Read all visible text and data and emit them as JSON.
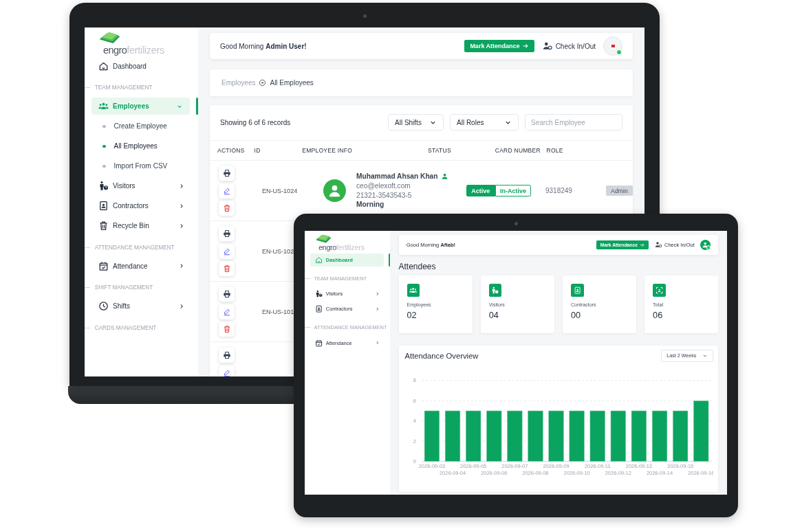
{
  "laptop": {
    "sidebar": {
      "logo": {
        "brand": "engro",
        "suffix": "fertilizers"
      },
      "items": [
        {
          "kind": "dashboard",
          "label": "Dashboard",
          "selected": false
        },
        {
          "kind": "section",
          "label": "TEAM MANAGEMENT"
        },
        {
          "kind": "employees",
          "label": "Employees",
          "selected": true,
          "expanded": true,
          "children": [
            {
              "label": "Create Employee",
              "selected": false
            },
            {
              "label": "All Employees",
              "selected": true
            },
            {
              "label": "Import From CSV",
              "selected": false
            }
          ]
        },
        {
          "kind": "visitors",
          "label": "Visitors",
          "selected": false,
          "expanded": false
        },
        {
          "kind": "contractors",
          "label": "Contractors",
          "selected": false,
          "expanded": false
        },
        {
          "kind": "recycle",
          "label": "Recycle Bin",
          "selected": false,
          "expanded": false
        },
        {
          "kind": "section",
          "label": "ATTENDANCE MANAGEMENT"
        },
        {
          "kind": "attendance",
          "label": "Attendance",
          "selected": false,
          "expanded": false
        },
        {
          "kind": "section",
          "label": "SHIFT MANAGEMENT"
        },
        {
          "kind": "shifts",
          "label": "Shifts",
          "selected": false,
          "expanded": false
        },
        {
          "kind": "section",
          "label": "CARDS MANAGEMENT"
        }
      ]
    },
    "header": {
      "greeting": "Good Morning **Admin User!**",
      "action": "Mark Attendance",
      "check": "Check In/Out",
      "avatar": {
        "kind": "logo",
        "online": true
      }
    },
    "breadcrumb": [
      {
        "label": "Employees",
        "selected": false
      },
      {
        "label": "All Employees",
        "selected": true
      }
    ],
    "toolbar": {
      "summary": "Showing 6 of 6 records",
      "filters": [
        "All Shifts",
        "All Roles"
      ],
      "search": {
        "placeholder": "Search Employee"
      }
    },
    "table": {
      "columns": [
        "ACTIONS",
        "ID",
        "EMPLOYEE INFO",
        "STATUS",
        "CARD NUMBER",
        "ROLE"
      ],
      "rows": [
        {
          "kind": "full",
          "id": "EN-US-1024",
          "name": "Muhammad Ahsan Khan",
          "email": "ceo@elexoft.com",
          "cnic": "21321-3543543-5",
          "shift": "Morning",
          "status": [
            {
              "label": "Active",
              "selected": true
            },
            {
              "label": "In-Active",
              "selected": false
            }
          ],
          "card": "9318249",
          "role": "Admin"
        },
        {
          "kind": "partial",
          "id": "EN-US-102"
        },
        {
          "kind": "partial",
          "id": "EN-US-101"
        },
        {
          "kind": "cut"
        }
      ]
    }
  },
  "tablet": {
    "sidebar": {
      "logo": {
        "brand": "engro",
        "suffix": "fertilizers"
      },
      "items": [
        {
          "kind": "dashboard",
          "label": "Dashboard",
          "selected": true
        },
        {
          "kind": "section",
          "label": "TEAM MANAGEMENT"
        },
        {
          "kind": "visitors",
          "label": "Visitors",
          "selected": false,
          "expanded": false
        },
        {
          "kind": "contractors",
          "label": "Contractors",
          "selected": false,
          "expanded": false
        },
        {
          "kind": "section",
          "label": "ATTENDANCE MANAGEMENT"
        },
        {
          "kind": "attendance",
          "label": "Attendance",
          "selected": false,
          "expanded": false
        }
      ]
    },
    "header": {
      "greeting": "Good Morning **Aftab!**",
      "action": "Mark Attendance",
      "check": "Check In/Out",
      "avatar": {
        "kind": "person",
        "online": true
      }
    },
    "title": "Attendees",
    "stats": [
      {
        "kind": "employees",
        "label": "Employees",
        "value": "02"
      },
      {
        "kind": "visitors",
        "label": "Visitors",
        "value": "04"
      },
      {
        "kind": "contractors",
        "label": "Contractors",
        "value": "00"
      },
      {
        "kind": "total",
        "label": "Total",
        "value": "06"
      }
    ],
    "chart_card": {
      "title": "Attendance Overview",
      "range": "Last 2 Weeks",
      "chart_data": {
        "type": "bar",
        "categories": [
          "2026-09-03",
          "2026-09-04",
          "2026-09-05",
          "2026-09-06",
          "2026-09-07",
          "2026-09-08",
          "2026-09-09",
          "2026-09-10",
          "2026-09-11",
          "2026-09-12",
          "2026-09-13",
          "2026-09-14",
          "2026-09-15",
          "2026-09-16"
        ],
        "values": [
          5,
          5,
          5,
          5,
          5,
          5,
          5,
          5,
          5,
          5,
          5,
          5,
          5,
          6
        ],
        "ylim": [
          0,
          8
        ],
        "yticks": [
          0,
          2,
          4,
          6,
          8
        ],
        "grid": true
      }
    }
  }
}
